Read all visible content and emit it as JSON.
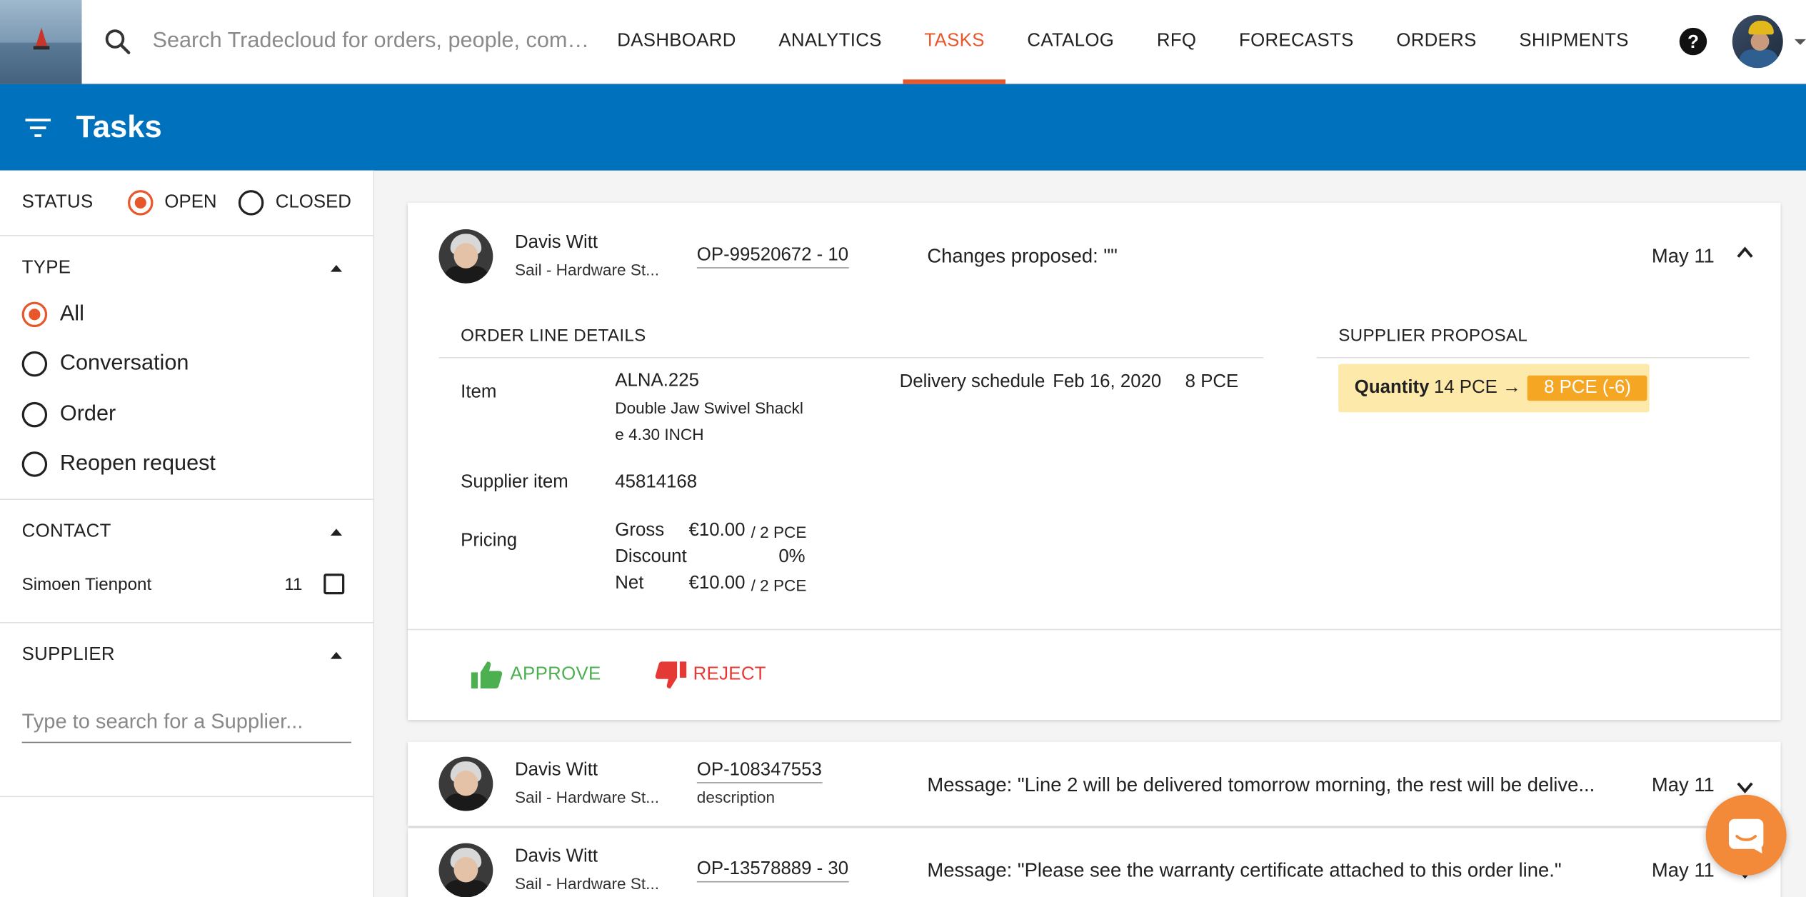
{
  "search": {
    "placeholder": "Search Tradecloud for orders, people, compan..."
  },
  "nav": {
    "items": [
      {
        "label": "DASHBOARD"
      },
      {
        "label": "ANALYTICS"
      },
      {
        "label": "TASKS"
      },
      {
        "label": "CATALOG"
      },
      {
        "label": "RFQ"
      },
      {
        "label": "FORECASTS"
      },
      {
        "label": "ORDERS"
      },
      {
        "label": "SHIPMENTS"
      }
    ],
    "active": "TASKS"
  },
  "header": {
    "title": "Tasks"
  },
  "filters": {
    "status": {
      "label": "STATUS",
      "options": [
        "OPEN",
        "CLOSED"
      ],
      "selected": "OPEN"
    },
    "type": {
      "label": "TYPE",
      "options": [
        "All",
        "Conversation",
        "Order",
        "Reopen request"
      ],
      "selected": "All"
    },
    "contact": {
      "label": "CONTACT",
      "items": [
        {
          "name": "Simoen Tienpont",
          "count": "11"
        }
      ]
    },
    "supplier": {
      "label": "SUPPLIER",
      "placeholder": "Type to search for a Supplier..."
    }
  },
  "tasks": [
    {
      "name": "Davis Witt",
      "company": "Sail - Hardware St...",
      "order": "OP-99520672 - 10",
      "message": "Changes proposed: \"\"",
      "date": "May 11",
      "details": {
        "order_line_title": "ORDER LINE DETAILS",
        "item_label": "Item",
        "item_code": "ALNA.225",
        "item_desc_1": "Double Jaw Swivel Shackl",
        "item_desc_2": "e 4.30 INCH",
        "delivery_label": "Delivery schedule",
        "delivery_date": "Feb 16, 2020",
        "delivery_qty": "8 PCE",
        "supplier_item_label": "Supplier item",
        "supplier_item": "45814168",
        "pricing_label": "Pricing",
        "gross_label": "Gross",
        "gross_value": "€10.00",
        "gross_unit": "/ 2 PCE",
        "discount_label": "Discount",
        "discount_value": "0%",
        "net_label": "Net",
        "net_value": "€10.00",
        "net_unit": "/ 2 PCE",
        "proposal_title": "SUPPLIER PROPOSAL",
        "proposal_label": "Quantity",
        "proposal_old": "14 PCE →",
        "proposal_new": "8 PCE (-6)"
      },
      "actions": {
        "approve": "APPROVE",
        "reject": "REJECT"
      }
    },
    {
      "name": "Davis Witt",
      "company": "Sail - Hardware St...",
      "order": "OP-108347553",
      "order_sub": "description",
      "message": "Message: \"Line 2 will be delivered tomorrow morning, the rest will be delive...",
      "date": "May 11"
    },
    {
      "name": "Davis Witt",
      "company": "Sail - Hardware St...",
      "order": "OP-13578889 - 30",
      "message": "Message: \"Please see the warranty certificate attached to this order line.\"",
      "date": "May 11"
    }
  ],
  "icons": {
    "search": "search-icon",
    "help": "help-icon",
    "filter": "filter-icon",
    "chat": "chat-icon"
  },
  "colors": {
    "accent": "#e8572a",
    "header_blue": "#0072bd",
    "approve": "#4caf50",
    "reject": "#e53935",
    "proposal_bg": "#fde9a9",
    "proposal_badge": "#f5a623",
    "chat_fab": "#f28a3a"
  }
}
